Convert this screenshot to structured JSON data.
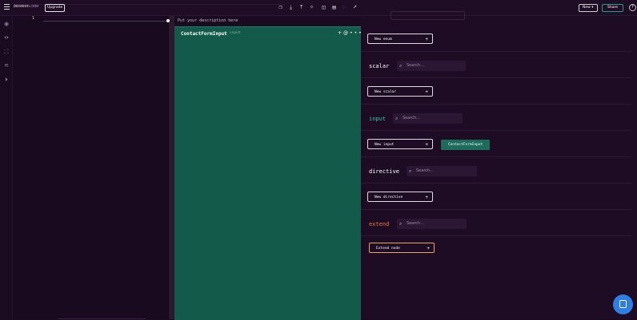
{
  "header": {
    "project": "obstest",
    "separator": "/",
    "section": "Code",
    "upgrade_label": "Upgrade",
    "new_label": "New ▾",
    "share_label": "Share",
    "help_glyph": "?",
    "toolbar_icons": [
      "copy-icon",
      "download-icon",
      "upload-icon",
      "lightbulb-icon",
      "book-icon",
      "file-icon",
      "play-icon",
      "rocket-icon"
    ]
  },
  "sidebar": {
    "icons": [
      "eye-icon",
      "code-icon",
      "fullscreen-icon",
      "layers-icon",
      "play-circle-icon"
    ],
    "active": "code-icon"
  },
  "editor": {
    "line_number": "1"
  },
  "description": {
    "placeholder": "Put your description here"
  },
  "canvas": {
    "type_name": "ContactFormInput",
    "type_kind": "input",
    "tools": [
      "+",
      "@",
      "•••"
    ]
  },
  "panel": {
    "enum": {
      "new_label": "New enum"
    },
    "scalar": {
      "title": "scalar",
      "search_placeholder": "Search...",
      "new_label": "New scalar"
    },
    "input": {
      "title": "input",
      "search_placeholder": "Search...",
      "new_label": "New input",
      "items": [
        "ContactFormInput"
      ]
    },
    "directive": {
      "title": "directive",
      "search_placeholder": "Search...",
      "new_label": "New directive"
    },
    "extend": {
      "title": "extend",
      "search_placeholder": "Search...",
      "new_label": "Extend node"
    },
    "plus": "+"
  },
  "colors": {
    "background": "#1d0c24",
    "canvas": "#135a4b",
    "scalar": "#ffffff",
    "input": "#38c7b0",
    "directive": "#ffffff",
    "extend": "#f07a3a",
    "extend_border": "#e8a860",
    "share_border": "#1f9e84",
    "chip": "#1d6b5b",
    "chat": "#2f7fe3"
  }
}
